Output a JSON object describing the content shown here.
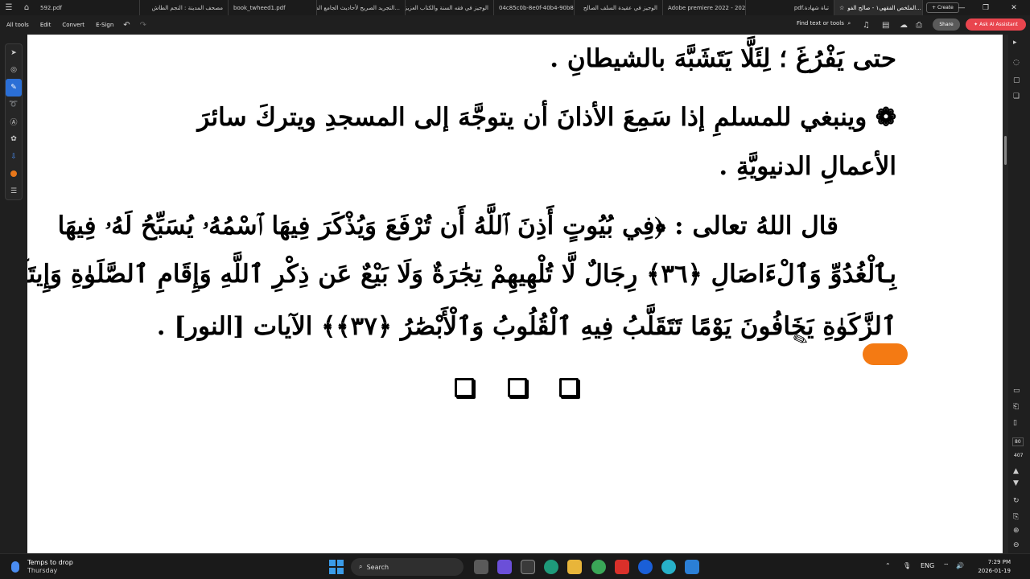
{
  "tabs": [
    {
      "label": "592.pdf"
    },
    {
      "label": "مصحف المدينة : النجم الطاش"
    },
    {
      "label": "book_twheed1.pdf"
    },
    {
      "label": "التجريد الصريح لأحاديث الجامع الص..."
    },
    {
      "label": "الوجيز في فقه السنة والكتاب العزيز"
    },
    {
      "label": "04c85c0b-8e0f-40b4-90b8-bc..."
    },
    {
      "label": "الوجيز في عقيدة السلف الصالح"
    },
    {
      "label": "Adobe premiere 2022 - 2023 -..."
    },
    {
      "label": "pdf.تباة شهادة"
    },
    {
      "label": "الملخص الفقهي١ - صالح الفو..."
    }
  ],
  "create_label": "Create",
  "toolbar": {
    "all_tools": "All tools",
    "edit": "Edit",
    "convert": "Convert",
    "esign": "E-Sign",
    "find": "Find text or tools",
    "share": "Share",
    "ask_ai": "Ask AI Assistant"
  },
  "document": {
    "line1": "حتى يَفْرُغَ ؛ لِئَلَّا يَتَشَبَّهَ بالشيطانِ .",
    "line2": "❁ وينبغي للمسلمِ إذا سَمِعَ الأذانَ أن يتوجَّهَ إلى المسجدِ ويتركَ سائرَ",
    "line3": "الأعمالِ الدنيويَّةِ .",
    "line4": "قال اللهُ تعالى : ﴿فِي بُيُوتٍ أَذِنَ ٱللَّهُ أَن تُرْفَعَ وَيُذْكَرَ فِيهَا ٱسْمُهُۥ يُسَبِّحُ لَهُۥ فِيهَا",
    "line5": "بِٱلْغُدُوِّ وَٱلْءَاصَالِ ﴿٣٦﴾ رِجَالٌ لَّا تُلْهِيهِمْ تِجَٰرَةٌ وَلَا بَيْعٌ عَن ذِكْرِ ٱللَّهِ وَإِقَامِ ٱلصَّلَوٰةِ وَإِيتَآءِ",
    "line6": "ٱلزَّكَوٰةِ يَخَافُونَ يَوْمًا تَتَقَلَّبُ فِيهِ ٱلْقُلُوبُ وَٱلْأَبْصَٰرُ ﴿٣٧﴾﴾ الآيات [النور] ."
  },
  "right_panel": {
    "page_current": "80",
    "page_total": "407"
  },
  "taskbar": {
    "weather_title": "Temps to drop",
    "weather_sub": "Thursday",
    "search": "Search",
    "lang": "ENG",
    "time": "7:29 PM",
    "date": "2026-01-19"
  },
  "colors": {
    "accent": "#2b6fd6",
    "ai": "#e9454e",
    "highlight": "#f47a13"
  }
}
